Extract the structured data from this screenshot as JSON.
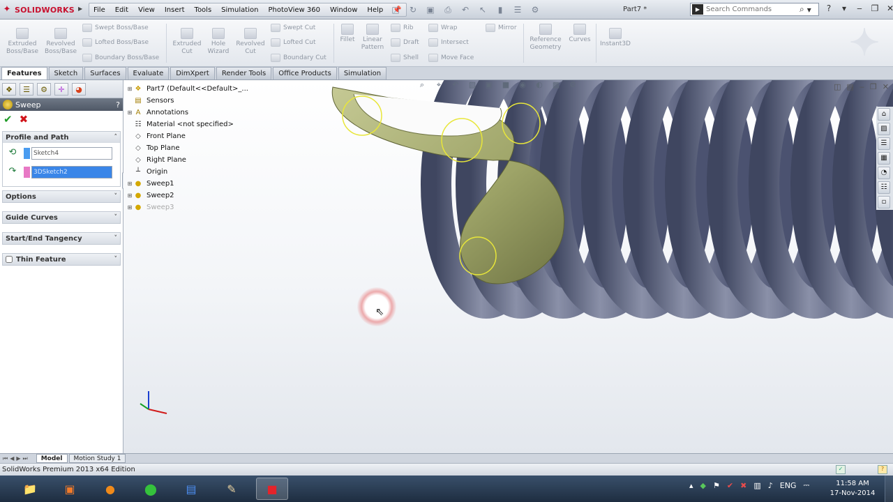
{
  "app": {
    "logo_text": "SOLIDWORKS",
    "menu": [
      "File",
      "Edit",
      "View",
      "Insert",
      "Tools",
      "Simulation",
      "PhotoView 360",
      "Window",
      "Help"
    ],
    "doc_title": "Part7 *",
    "search_placeholder": "Search Commands"
  },
  "command_manager": {
    "large_tools": [
      {
        "label": "Extruded\nBoss/Base",
        "icon": "extruded-boss-icon"
      },
      {
        "label": "Revolved\nBoss/Base",
        "icon": "revolved-boss-icon"
      },
      {
        "label": "Extruded\nCut",
        "icon": "extruded-cut-icon"
      },
      {
        "label": "Hole\nWizard",
        "icon": "hole-wizard-icon"
      },
      {
        "label": "Revolved\nCut",
        "icon": "revolved-cut-icon"
      },
      {
        "label": "Fillet",
        "icon": "fillet-icon"
      },
      {
        "label": "Linear\nPattern",
        "icon": "linear-pattern-icon"
      },
      {
        "label": "Reference\nGeometry",
        "icon": "reference-geometry-icon"
      },
      {
        "label": "Curves",
        "icon": "curves-icon"
      },
      {
        "label": "Instant3D",
        "icon": "instant3d-icon"
      }
    ],
    "small_tools": [
      {
        "label": "Swept Boss/Base"
      },
      {
        "label": "Lofted Boss/Base"
      },
      {
        "label": "Boundary Boss/Base"
      },
      {
        "label": "Swept Cut"
      },
      {
        "label": "Lofted Cut"
      },
      {
        "label": "Boundary Cut"
      },
      {
        "label": "Rib"
      },
      {
        "label": "Draft"
      },
      {
        "label": "Shell"
      },
      {
        "label": "Wrap"
      },
      {
        "label": "Intersect"
      },
      {
        "label": "Move Face"
      },
      {
        "label": "Mirror"
      }
    ]
  },
  "tabs": [
    "Features",
    "Sketch",
    "Surfaces",
    "Evaluate",
    "DimXpert",
    "Render Tools",
    "Office Products",
    "Simulation"
  ],
  "property_manager": {
    "title": "Sweep",
    "help": "?",
    "groups": {
      "profile_and_path": "Profile and Path",
      "options": "Options",
      "guide_curves": "Guide Curves",
      "start_end_tangency": "Start/End Tangency",
      "thin_feature": "Thin Feature"
    },
    "profile_value": "Sketch4",
    "path_value": "3DSketch2",
    "profile_color": "#4a9cf0",
    "path_color": "#e879c5"
  },
  "feature_tree": [
    {
      "label": "Part7  (Default<<Default>_...",
      "icon": "part-icon",
      "expandable": true
    },
    {
      "label": "Sensors",
      "icon": "sensors-icon",
      "expandable": false
    },
    {
      "label": "Annotations",
      "icon": "annotations-icon",
      "expandable": true
    },
    {
      "label": "Material <not specified>",
      "icon": "material-icon",
      "expandable": false
    },
    {
      "label": "Front Plane",
      "icon": "plane-icon",
      "expandable": false
    },
    {
      "label": "Top Plane",
      "icon": "plane-icon",
      "expandable": false
    },
    {
      "label": "Right Plane",
      "icon": "plane-icon",
      "expandable": false
    },
    {
      "label": "Origin",
      "icon": "origin-icon",
      "expandable": false
    },
    {
      "label": "Sweep1",
      "icon": "sweep-icon",
      "expandable": true
    },
    {
      "label": "Sweep2",
      "icon": "sweep-icon",
      "expandable": true
    },
    {
      "label": "Sweep3",
      "icon": "sweep-icon",
      "expandable": true,
      "faded": true
    }
  ],
  "bottom_tabs": [
    "Model",
    "Motion Study 1"
  ],
  "status_text": "SolidWorks Premium 2013 x64 Edition",
  "taskbar": {
    "tray_lang": "ENG",
    "clock_time": "11:58 AM",
    "clock_date": "17-Nov-2014"
  },
  "colors": {
    "spring_coil": "#5f6680",
    "sweep_preview": "#9ea468",
    "profile_circle": "#e8e63a",
    "accent_red": "#c8102e"
  }
}
